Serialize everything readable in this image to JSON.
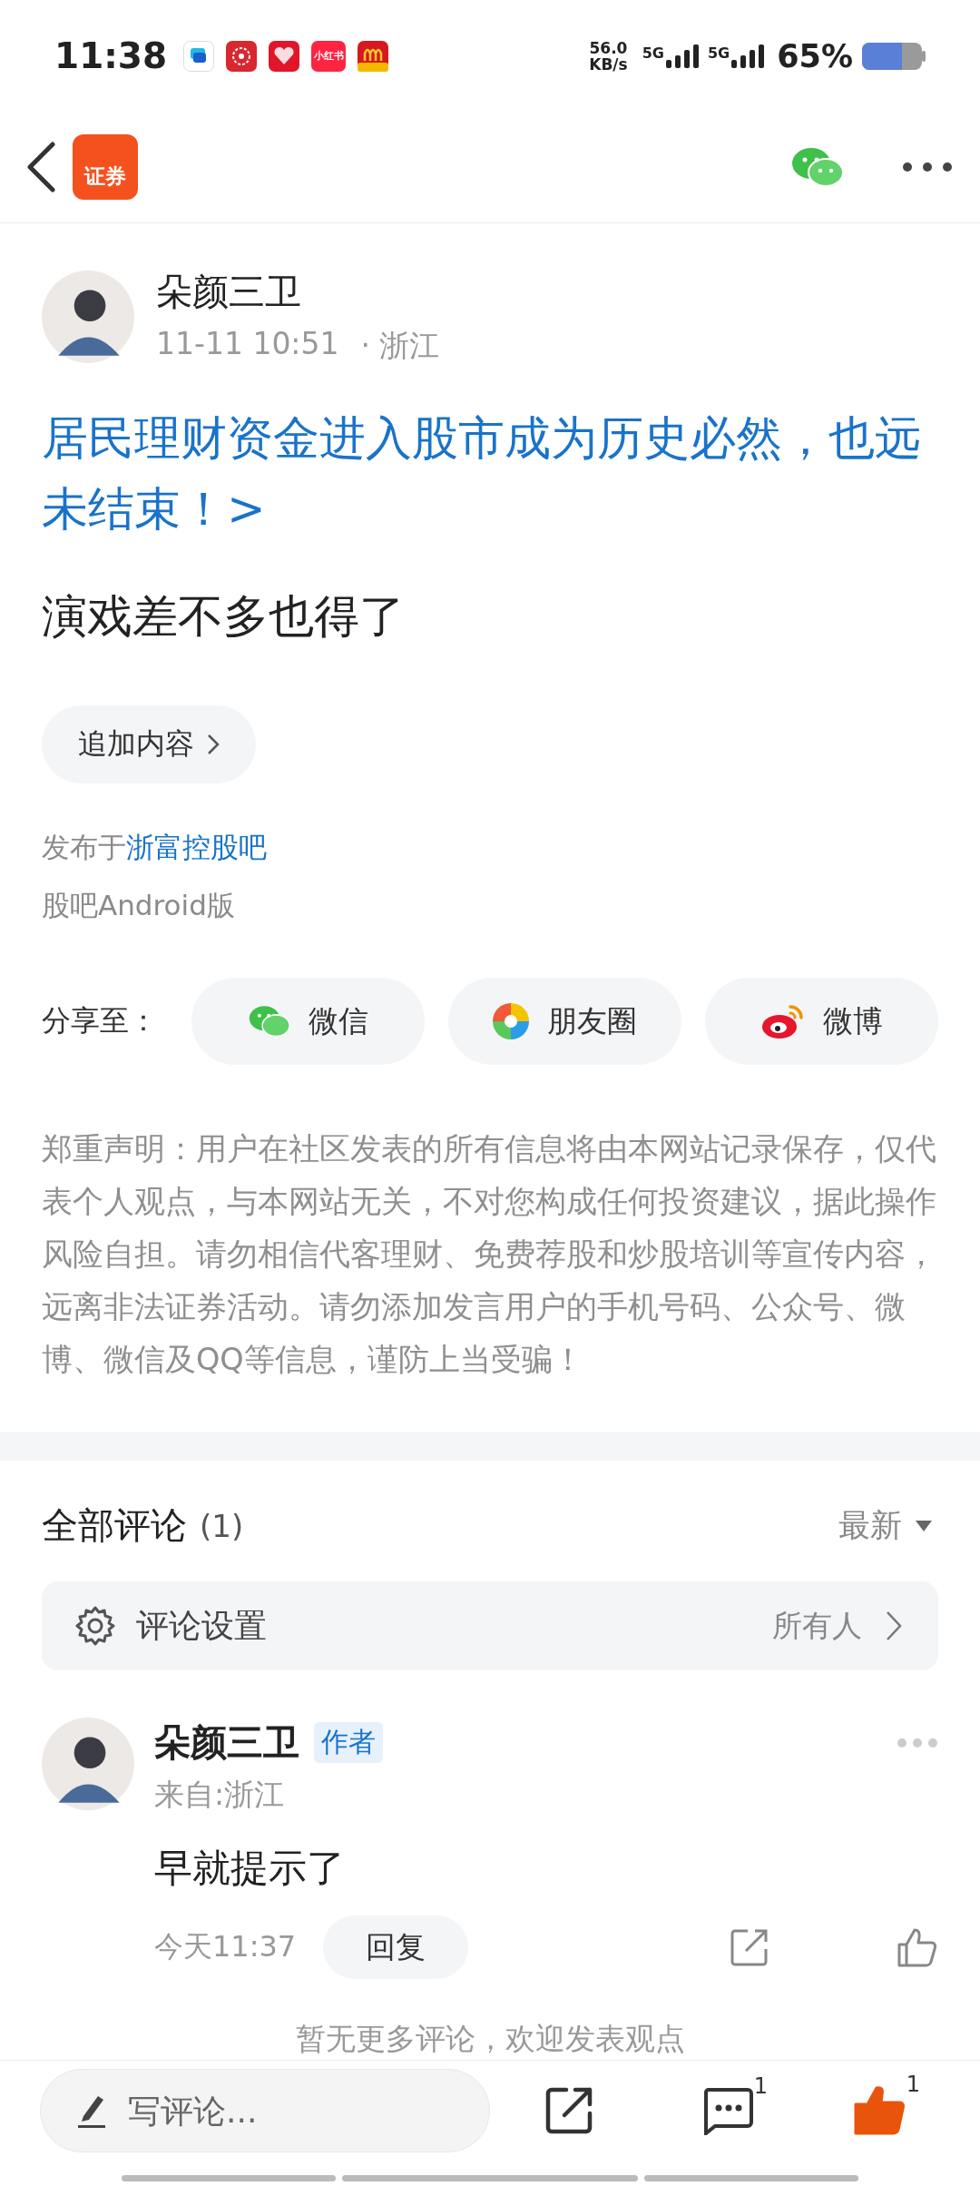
{
  "status_bar": {
    "time": "11:38",
    "notification_icons": [
      {
        "kind": "chat"
      },
      {
        "kind": "flower"
      },
      {
        "kind": "heart"
      },
      {
        "kind": "note",
        "label": "小红书"
      },
      {
        "kind": "arches"
      }
    ],
    "net_speed": "56.0",
    "net_unit": "KB/s",
    "sim_1": "5G",
    "sim_2": "5G",
    "battery": "65%"
  },
  "nav": {
    "logo_text": "证券"
  },
  "post": {
    "author": "朵颜三卫",
    "date": "11-11 10:51",
    "location": "· 浙江",
    "title": "居民理财资金进入股市成为历史必然，也远未结束！>",
    "body": "演戏差不多也得了",
    "append_button": "追加内容",
    "published_prefix": "发布于",
    "forum": "浙富控股吧",
    "client": "股吧Android版",
    "share_label": "分享至：",
    "share": [
      {
        "kind": "wechat",
        "label": "微信"
      },
      {
        "kind": "moments",
        "label": "朋友圈"
      },
      {
        "kind": "weibo",
        "label": "微博"
      }
    ],
    "disclaimer": "郑重声明：用户在社区发表的所有信息将由本网站记录保存，仅代表个人观点，与本网站无关，不对您构成任何投资建议，据此操作风险自担。请勿相信代客理财、免费荐股和炒股培训等宣传内容，远离非法证券活动。请勿添加发言用户的手机号码、公众号、微博、微信及QQ等信息，谨防上当受骗！"
  },
  "comments": {
    "title": "全部评论",
    "count": "(1)",
    "sort": "最新",
    "settings_label": "评论设置",
    "settings_value": "所有人",
    "items": [
      {
        "author": "朵颜三卫",
        "badge": "作者",
        "from": "来自:浙江",
        "text": "早就提示了",
        "time": "今天11:37",
        "reply": "回复"
      }
    ],
    "end_note": "暂无更多评论，欢迎发表观点"
  },
  "bottom_bar": {
    "placeholder": "写评论...",
    "comment_count": "1",
    "like_count": "1",
    "liked": true
  }
}
